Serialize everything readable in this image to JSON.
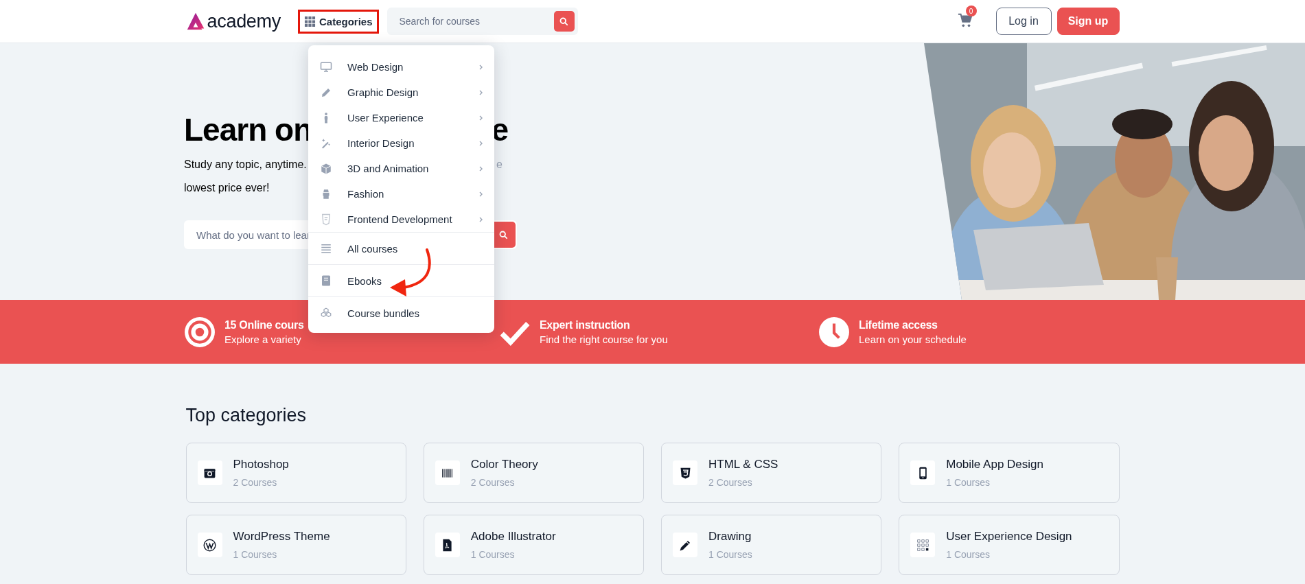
{
  "header": {
    "logo": "academy",
    "categories_button": {
      "label": "Categories",
      "highlighted": true
    },
    "search": {
      "placeholder": "Search for courses"
    },
    "cart_count": "0",
    "buttons": [
      {
        "label": "Log in",
        "kind": "outline"
      },
      {
        "label": "Sign up",
        "kind": "primary"
      }
    ]
  },
  "hero": {
    "title_parts": [
      "Learn on",
      "e"
    ],
    "subtitle_parts": [
      "Study any topic, anytime.",
      "e"
    ],
    "subtitle_line_2": "lowest price ever!",
    "search": {
      "placeholder": "What do you want to lear"
    }
  },
  "menu": {
    "items": [
      {
        "label": "Web Design",
        "kind": "category",
        "has_submenu": true
      },
      {
        "label": "Graphic Design",
        "kind": "category",
        "has_submenu": true
      },
      {
        "label": "User Experience",
        "kind": "category",
        "has_submenu": true
      },
      {
        "label": "Interior Design",
        "kind": "category",
        "has_submenu": true
      },
      {
        "label": "3D and Animation",
        "kind": "category",
        "has_submenu": true
      },
      {
        "label": "Fashion",
        "kind": "category",
        "has_submenu": true
      },
      {
        "label": "Frontend Development",
        "kind": "category",
        "has_submenu": true
      },
      {
        "label": "All courses",
        "kind": "link",
        "has_submenu": false
      },
      {
        "label": "Ebooks",
        "kind": "link",
        "has_submenu": false
      },
      {
        "label": "Course bundles",
        "kind": "link",
        "has_submenu": false
      }
    ]
  },
  "annotation": {
    "kind": "curved_arrow"
  },
  "features": [
    {
      "title": "15 Online cours",
      "subtitle": "Explore a variety"
    },
    {
      "title": "Expert instruction",
      "subtitle": "Find the right course for you"
    },
    {
      "title": "Lifetime access",
      "subtitle": "Learn on your schedule"
    }
  ],
  "top_categories": {
    "title": "Top categories",
    "cards": [
      {
        "name": "Photoshop",
        "count": "2 Courses"
      },
      {
        "name": "Color Theory",
        "count": "2 Courses"
      },
      {
        "name": "HTML & CSS",
        "count": "2 Courses"
      },
      {
        "name": "Mobile App Design",
        "count": "1 Courses"
      },
      {
        "name": "WordPress Theme",
        "count": "1 Courses"
      },
      {
        "name": "Adobe Illustrator",
        "count": "1 Courses"
      },
      {
        "name": "Drawing",
        "count": "1 Courses"
      },
      {
        "name": "User Experience Design",
        "count": "1 Courses"
      }
    ]
  }
}
